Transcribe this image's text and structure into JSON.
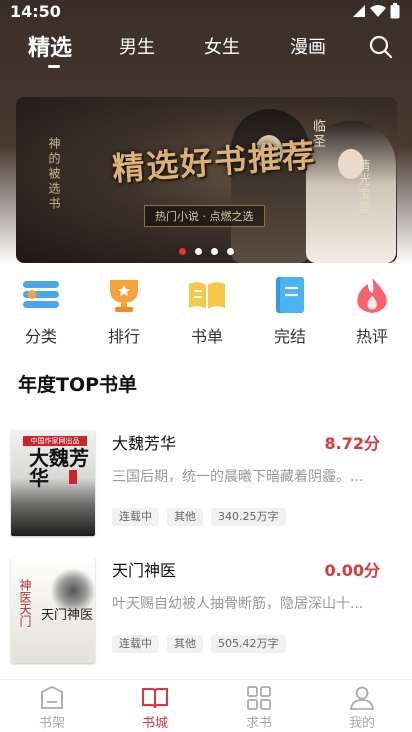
{
  "status_bar": {
    "time": "14:50"
  },
  "top_tabs": [
    {
      "label": "精选",
      "active": true
    },
    {
      "label": "男生",
      "active": false
    },
    {
      "label": "女生",
      "active": false
    },
    {
      "label": "漫画",
      "active": false
    }
  ],
  "banner": {
    "title": "精选好书推荐",
    "subtitle": "热门小说 · 点燃之选",
    "side_text_left": "神的被选书",
    "side_text_right_1": "临圣",
    "side_text_right_2": "清光宝鉴",
    "slide_count": 4,
    "active_slide": 1
  },
  "quick_entries": [
    {
      "label": "分类",
      "icon": "category-icon"
    },
    {
      "label": "排行",
      "icon": "trophy-icon"
    },
    {
      "label": "书单",
      "icon": "open-book-icon"
    },
    {
      "label": "完结",
      "icon": "completed-book-icon"
    },
    {
      "label": "热评",
      "icon": "flame-icon"
    }
  ],
  "section": {
    "title": "年度TOP书单"
  },
  "books": [
    {
      "title": "大魏芳华",
      "score": "8.72分",
      "description": "三国后期，统一的晨曦下暗藏着阴霾。...",
      "tags": [
        "连载中",
        "其他",
        "340.25万字"
      ],
      "cover": {
        "publisher": "中国作家网出品",
        "cover_title": "大魏芳华"
      }
    },
    {
      "title": "天门神医",
      "score": "0.00分",
      "description": "叶天赐自幼被人抽骨断筋，隐居深山十...",
      "tags": [
        "连载中",
        "其他",
        "505.42万字"
      ],
      "cover": {
        "side_text": "神医天门",
        "cover_title": "天门神医"
      }
    }
  ],
  "bottom_nav": [
    {
      "label": "书架",
      "icon": "bookshelf-icon",
      "active": false
    },
    {
      "label": "书城",
      "icon": "bookstore-icon",
      "active": true
    },
    {
      "label": "求书",
      "icon": "grid-icon",
      "active": false
    },
    {
      "label": "我的",
      "icon": "profile-icon",
      "active": false
    }
  ],
  "colors": {
    "accent": "#e0363f",
    "header_bg": "#3a2e28",
    "tag_bg": "#f1f1f1"
  }
}
